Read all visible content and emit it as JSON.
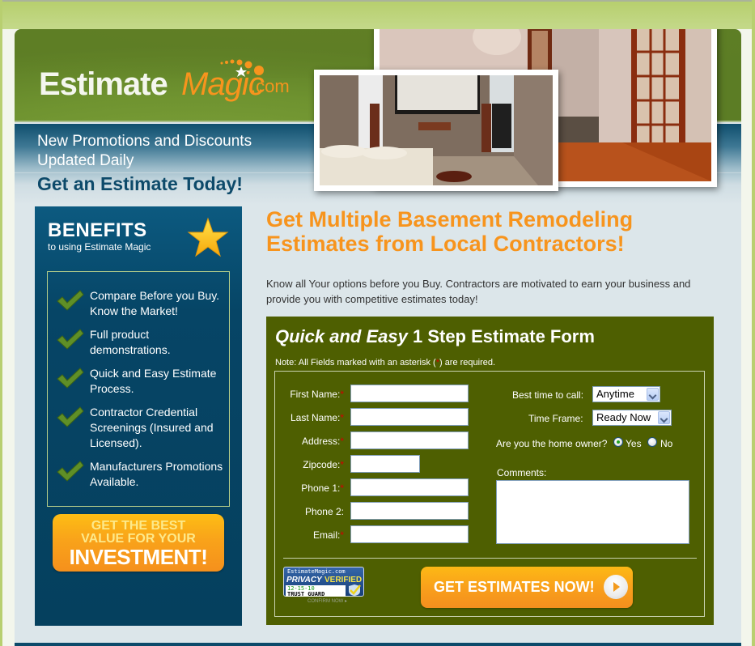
{
  "brand": {
    "logo_primary": "Estimate",
    "logo_accent": "Magic",
    "logo_suffix": ".com",
    "accent_color": "#f7941d",
    "green_color": "#4e5f01",
    "blue_color": "#05405e"
  },
  "header": {
    "promo_line1": "New Promotions and Discounts",
    "promo_line2": "Updated Daily",
    "tagline": "Get an Estimate Today!",
    "photos": [
      "finished basement hallway with french doors",
      "basement home theater room"
    ]
  },
  "sidebar": {
    "title": "BENEFITS",
    "subtitle": "to using Estimate Magic",
    "items": [
      {
        "label": "Compare Before you Buy. Know the Market!"
      },
      {
        "label": "Full product demonstrations."
      },
      {
        "label": "Quick and Easy Estimate Process."
      },
      {
        "label": "Contractor Credential Screenings (Insured and Licensed)."
      },
      {
        "label": "Manufacturers Promotions Available."
      }
    ],
    "cta_line1": "GET THE BEST",
    "cta_line2": "VALUE FOR YOUR",
    "cta_line3": "INVESTMENT!"
  },
  "main": {
    "headline_line1": "Get Multiple Basement Remodeling",
    "headline_line2": "Estimates from Local Contractors!",
    "intro": "Know all Your options before you Buy. Contractors are motivated to earn your business and provide you with competitive estimates today!"
  },
  "form": {
    "title_italic": "Quick and Easy",
    "title_rest": " 1 Step Estimate Form",
    "note_prefix": "Note: All Fields marked with an asterisk (",
    "note_asterisk": "*",
    "note_suffix": ") are required.",
    "fields": [
      {
        "label": "First Name:",
        "required": "*",
        "value": ""
      },
      {
        "label": "Last Name:",
        "required": "*",
        "value": ""
      },
      {
        "label": "Address:",
        "required": "*",
        "value": ""
      },
      {
        "label": "Zipcode:",
        "required": "*",
        "value": ""
      },
      {
        "label": "Phone 1:",
        "required": "*",
        "value": ""
      },
      {
        "label": "Phone 2:",
        "required": "",
        "value": ""
      },
      {
        "label": "Email:",
        "required": "*",
        "value": ""
      }
    ],
    "best_time_label": "Best time to call:",
    "best_time_value": "Anytime",
    "time_frame_label": "Time Frame:",
    "time_frame_value": "Ready Now",
    "owner_question": "Are you the home owner?",
    "owner_yes": "Yes",
    "owner_no": "No",
    "owner_selected": "Yes",
    "comments_label": "Comments:",
    "comments_value": "",
    "submit_label": "GET ESTIMATES NOW!",
    "trust_badge": {
      "site": "EstimateMagic.com",
      "privacy": "PRIVACY",
      "verified": "VERIFIED",
      "date": "12-15-10",
      "guard": "TRUST GUARD",
      "confirm": "CONFIRM NOW ▸"
    }
  }
}
